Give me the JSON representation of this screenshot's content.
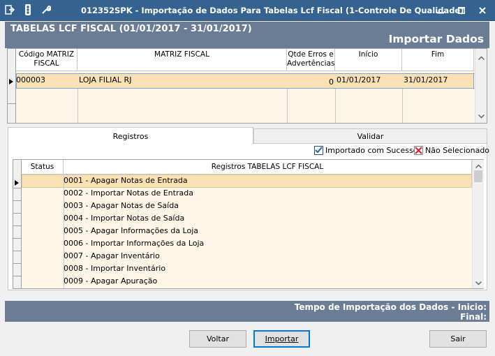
{
  "window": {
    "title": "012352SPK - Importação de Dados Para Tabelas Lcf Fiscal (1-Controle De Qualidade)"
  },
  "header": {
    "left_title": "TABELAS LCF FISCAL (01/01/2017 - 31/01/2017)",
    "right_title": "Importar Dados"
  },
  "matrix_grid": {
    "columns": [
      "Código MATRIZ FISCAL",
      "MATRIZ FISCAL",
      "Qtde Erros e Advertências",
      "Início",
      "Fim"
    ],
    "rows": [
      {
        "code": "000003",
        "name": "LOJA FILIAL RJ",
        "errors": "0",
        "start": "01/01/2017",
        "end": "31/01/2017"
      }
    ]
  },
  "tabs": {
    "registros": "Registros",
    "validar": "Validar"
  },
  "legend": {
    "imported": "Importado com Sucesso",
    "not_selected": "Não Selecionado"
  },
  "records_grid": {
    "columns": [
      "Status",
      "Registros TABELAS LCF FISCAL"
    ],
    "rows": [
      "0001 - Apagar Notas de Entrada",
      "0002 - Importar Notas de Entrada",
      "0003 - Apagar Notas de Saída",
      "0004 - Importar Notas de Saída",
      "0005 - Apagar Informações da Loja",
      "0006 - Importar Informações da Loja",
      "0007 - Apagar Inventário",
      "0008 - Importar Inventário",
      "0009 - Apagar Apuração"
    ]
  },
  "footer": {
    "time_label": "Tempo de Importação dos Dados - Inicio:",
    "final_label": "Final:"
  },
  "buttons": {
    "back": "Voltar",
    "import": "Importar",
    "exit": "Sair"
  },
  "colors": {
    "titlebar": "#35638f",
    "band": "#6a7d94",
    "grid_bg": "#fdf5e6",
    "selected_row": "#fae1b4"
  }
}
